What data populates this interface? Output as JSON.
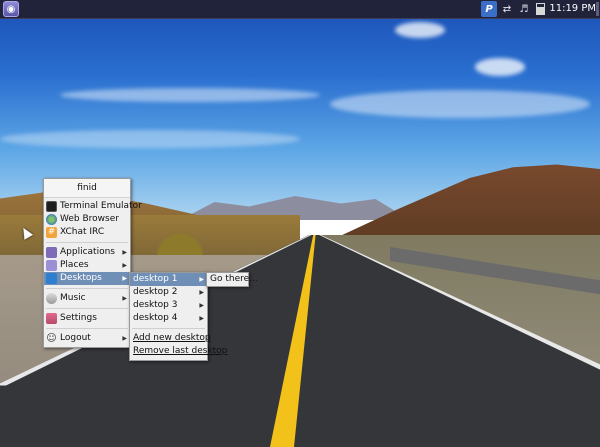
{
  "panel": {
    "clock": "11:19 PM",
    "tray_p": "P",
    "icons": {
      "launcher": "launcher-icon",
      "p": "p-tray-icon",
      "network": "network-icon",
      "volume": "volume-icon",
      "battery": "battery-icon"
    }
  },
  "main_menu": {
    "title": "finid",
    "items": [
      {
        "label": "Terminal Emulator",
        "icon": "terminal-icon"
      },
      {
        "label": "Web Browser",
        "icon": "web-browser-icon"
      },
      {
        "label": "XChat IRC",
        "icon": "xchat-icon"
      },
      {
        "label": "Applications",
        "icon": "applications-icon"
      },
      {
        "label": "Places",
        "icon": "places-icon"
      },
      {
        "label": "Desktops",
        "icon": "desktops-icon"
      },
      {
        "label": "Music",
        "icon": "music-icon"
      },
      {
        "label": "Settings",
        "icon": "settings-icon"
      },
      {
        "label": "Logout",
        "icon": "logout-icon"
      }
    ]
  },
  "desktops_menu": {
    "items": [
      "desktop 1",
      "desktop 2",
      "desktop 3",
      "desktop 4"
    ],
    "add": "Add new desktop",
    "remove": "Remove last desktop"
  },
  "gothere_menu": {
    "label": "Go there..."
  },
  "colors": {
    "highlight": "#6f8fb6",
    "panel": "#20233a",
    "menu_bg": "#efefef"
  }
}
